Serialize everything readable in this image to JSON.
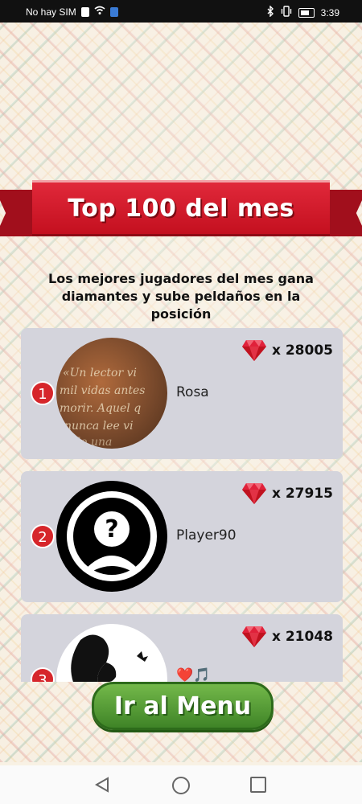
{
  "status_bar": {
    "carrier": "No hay SIM",
    "time": "3:39",
    "icons": [
      "download-icon",
      "wifi-icon",
      "app-icon",
      "bluetooth-icon",
      "vibrate-icon",
      "battery-icon"
    ]
  },
  "banner": {
    "title": "Top 100 del mes"
  },
  "subtitle": "Los mejores jugadores del mes gana diamantes y sube peldaños en la posición",
  "leaderboard": [
    {
      "rank": "1",
      "name": "Rosa",
      "score": "x 28005",
      "avatar": "text-book-photo"
    },
    {
      "rank": "2",
      "name": "Player90",
      "score": "x 27915",
      "avatar": "unknown-user-icon"
    },
    {
      "rank": "3",
      "name": "❤️🎵",
      "score": "x 21048",
      "avatar": "woman-silhouette"
    }
  ],
  "menu_button": {
    "label": "Ir al Menu"
  },
  "nav_bar": {
    "icons": [
      "back-icon",
      "home-icon",
      "recent-apps-icon"
    ]
  },
  "colors": {
    "accent_red": "#d6262b",
    "card_bg": "#d4d4dc",
    "button_green": "#4f9a32",
    "diamond": "#e0213a"
  }
}
